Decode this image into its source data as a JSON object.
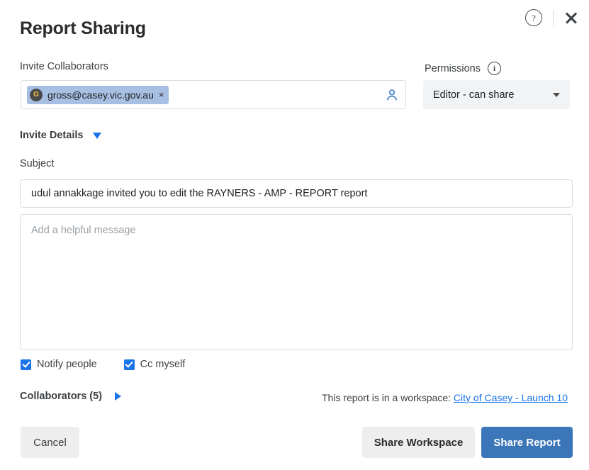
{
  "header": {
    "title": "Report Sharing",
    "help_icon": "help-circle-icon",
    "close_icon": "close-icon"
  },
  "invite": {
    "label": "Invite Collaborators",
    "chip": {
      "avatar_initial": "G",
      "email": "gross@casey.vic.gov.au",
      "remove_label": "×"
    },
    "contact_icon": "person-icon"
  },
  "permissions": {
    "label": "Permissions",
    "info_icon": "info-icon",
    "selected": "Editor - can share",
    "options": [
      "Editor - can share"
    ]
  },
  "invite_details": {
    "label": "Invite Details",
    "expanded": true,
    "toggle_icon": "triangle-down-icon"
  },
  "subject": {
    "label": "Subject",
    "value": "udul annakkage invited you to edit the RAYNERS - AMP - REPORT report"
  },
  "message": {
    "placeholder": "Add a helpful message",
    "value": ""
  },
  "options": {
    "notify_people": "Notify people",
    "cc_myself": "Cc myself"
  },
  "collaborators": {
    "label": "Collaborators (5)",
    "toggle_icon": "triangle-right-icon"
  },
  "workspace": {
    "prefix": "This report is in a workspace:",
    "link": "City of Casey - Launch 10"
  },
  "footer": {
    "cancel": "Cancel",
    "share_workspace": "Share Workspace",
    "share_report": "Share Report"
  },
  "colors": {
    "primary": "#3b76b8",
    "link": "#1a73e8",
    "chip_bg": "#a7bfe2",
    "button_gray": "#eeeeee"
  }
}
